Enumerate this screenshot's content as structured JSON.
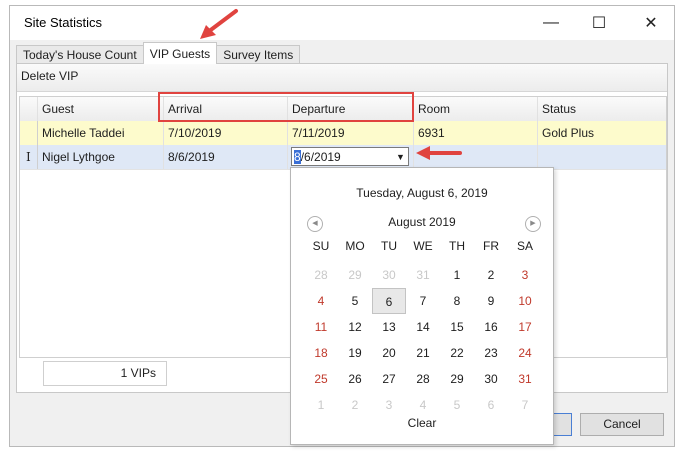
{
  "window": {
    "title": "Site Statistics",
    "minimize_glyph": "—",
    "maximize_glyph": "☐",
    "close_glyph": "✕"
  },
  "tabs": [
    {
      "label": "Today's House Count",
      "active": false
    },
    {
      "label": "VIP Guests",
      "active": true
    },
    {
      "label": "Survey Items",
      "active": false
    }
  ],
  "toolbar": {
    "delete_label": "Delete VIP"
  },
  "grid": {
    "columns": [
      "Guest",
      "Arrival",
      "Departure",
      "Room",
      "Status"
    ],
    "rows": [
      {
        "indicator": "",
        "guest": "Michelle Taddei",
        "arrival": "7/10/2019",
        "departure": "7/11/2019",
        "room": "6931",
        "status": "Gold Plus"
      },
      {
        "indicator": "I",
        "guest": "Nigel Lythgoe",
        "arrival": "8/6/2019",
        "departure": "8/6/2019",
        "room": "",
        "status": ""
      }
    ],
    "editor": {
      "caret_char": "8",
      "rest": "/6/2019",
      "dropdown_glyph": "▼"
    }
  },
  "footer": {
    "count": "1 VIPs"
  },
  "buttons": {
    "ok": "",
    "cancel": "Cancel"
  },
  "calendar": {
    "today_title": "Tuesday, August 6, 2019",
    "month_label": "August 2019",
    "prev_glyph": "◀",
    "next_glyph": "▶",
    "weekdays": [
      "SU",
      "MO",
      "TU",
      "WE",
      "TH",
      "FR",
      "SA"
    ],
    "weeks": [
      [
        "28",
        "29",
        "30",
        "31",
        "1",
        "2",
        "3"
      ],
      [
        "4",
        "5",
        "6",
        "7",
        "8",
        "9",
        "10"
      ],
      [
        "11",
        "12",
        "13",
        "14",
        "15",
        "16",
        "17"
      ],
      [
        "18",
        "19",
        "20",
        "21",
        "22",
        "23",
        "24"
      ],
      [
        "25",
        "26",
        "27",
        "28",
        "29",
        "30",
        "31"
      ],
      [
        "1",
        "2",
        "3",
        "4",
        "5",
        "6",
        "7"
      ]
    ],
    "selected_day": "6",
    "clear_label": "Clear"
  },
  "colors": {
    "annotation_red": "#e0433f",
    "row_yellow": "#fdfbcc",
    "row_selected": "#dfe8f6",
    "weekend_red": "#c0392b"
  }
}
